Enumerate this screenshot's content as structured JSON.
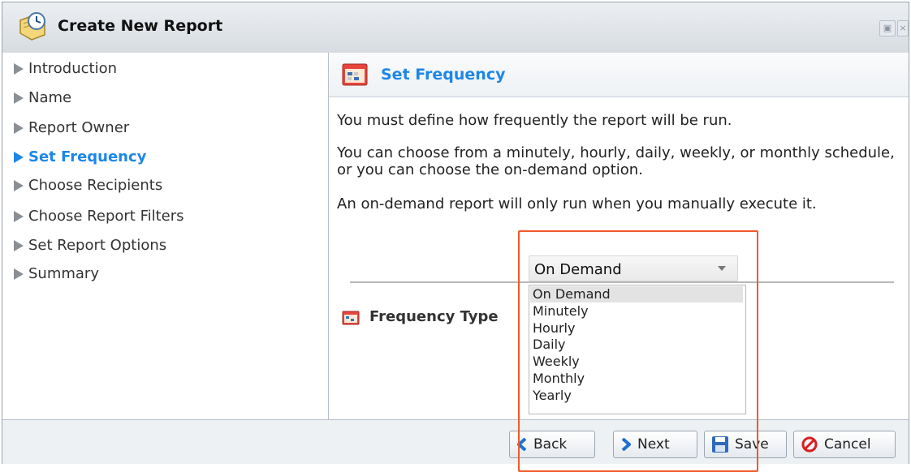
{
  "window": {
    "title": "Create New Report",
    "title_icon": "report-wizard-icon"
  },
  "titlebar_buttons": [
    "restore-icon",
    "close-icon"
  ],
  "nav": {
    "items": [
      {
        "label": "Introduction",
        "active": false
      },
      {
        "label": "Name",
        "active": false
      },
      {
        "label": "Report Owner",
        "active": false
      },
      {
        "label": "Set Frequency",
        "active": true
      },
      {
        "label": "Choose Recipients",
        "active": false
      },
      {
        "label": "Choose Report Filters",
        "active": false
      },
      {
        "label": "Set Report Options",
        "active": false
      },
      {
        "label": "Summary",
        "active": false
      }
    ]
  },
  "main": {
    "header": {
      "title": "Set Frequency",
      "icon": "calendar-icon"
    },
    "paragraphs": [
      "You must define how frequently the report will be run.",
      "You can choose from a minutely, hourly, daily, weekly, or monthly schedule, or you can choose the on-demand option.",
      "An on-demand report will only run when you manually execute it."
    ],
    "frequency": {
      "label": "Frequency Type",
      "value": "On Demand",
      "options": [
        "On Demand",
        "Minutely",
        "Hourly",
        "Daily",
        "Weekly",
        "Monthly",
        "Yearly"
      ],
      "highlight_color": "#f05a28"
    }
  },
  "footer": {
    "back_label": "Back",
    "next_label": "Next",
    "save_label": "Save",
    "cancel_label": "Cancel"
  },
  "colors": {
    "accent": "#1d87e8",
    "cancel": "#d81f1f",
    "highlight": "#f05a28"
  }
}
